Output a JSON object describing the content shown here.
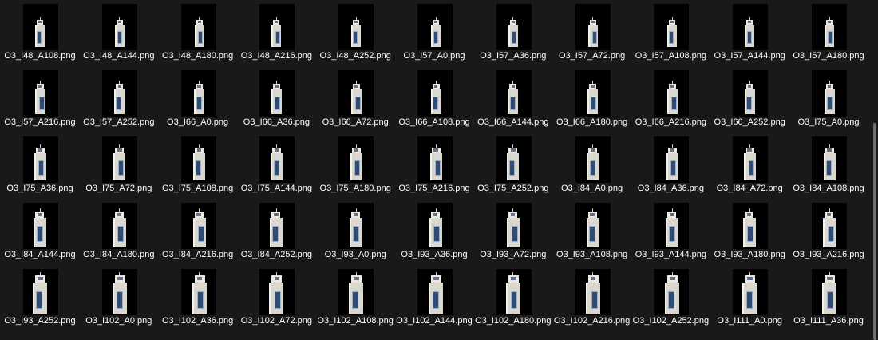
{
  "files": [
    {
      "name": "O3_I48_A108.png"
    },
    {
      "name": "O3_I48_A144.png"
    },
    {
      "name": "O3_I48_A180.png"
    },
    {
      "name": "O3_I48_A216.png"
    },
    {
      "name": "O3_I48_A252.png"
    },
    {
      "name": "O3_I57_A0.png"
    },
    {
      "name": "O3_I57_A36.png"
    },
    {
      "name": "O3_I57_A72.png"
    },
    {
      "name": "O3_I57_A108.png"
    },
    {
      "name": "O3_I57_A144.png"
    },
    {
      "name": "O3_I57_A180.png"
    },
    {
      "name": "O3_I57_A216.png"
    },
    {
      "name": "O3_I57_A252.png"
    },
    {
      "name": "O3_I66_A0.png"
    },
    {
      "name": "O3_I66_A36.png"
    },
    {
      "name": "O3_I66_A72.png"
    },
    {
      "name": "O3_I66_A108.png"
    },
    {
      "name": "O3_I66_A144.png"
    },
    {
      "name": "O3_I66_A180.png"
    },
    {
      "name": "O3_I66_A216.png"
    },
    {
      "name": "O3_I66_A252.png"
    },
    {
      "name": "O3_I75_A0.png"
    },
    {
      "name": "O3_I75_A36.png"
    },
    {
      "name": "O3_I75_A72.png"
    },
    {
      "name": "O3_I75_A108.png"
    },
    {
      "name": "O3_I75_A144.png"
    },
    {
      "name": "O3_I75_A180.png"
    },
    {
      "name": "O3_I75_A216.png"
    },
    {
      "name": "O3_I75_A252.png"
    },
    {
      "name": "O3_I84_A0.png"
    },
    {
      "name": "O3_I84_A36.png"
    },
    {
      "name": "O3_I84_A72.png"
    },
    {
      "name": "O3_I84_A108.png"
    },
    {
      "name": "O3_I84_A144.png"
    },
    {
      "name": "O3_I84_A180.png"
    },
    {
      "name": "O3_I84_A216.png"
    },
    {
      "name": "O3_I84_A252.png"
    },
    {
      "name": "O3_I93_A0.png"
    },
    {
      "name": "O3_I93_A36.png"
    },
    {
      "name": "O3_I93_A72.png"
    },
    {
      "name": "O3_I93_A108.png"
    },
    {
      "name": "O3_I93_A144.png"
    },
    {
      "name": "O3_I93_A180.png"
    },
    {
      "name": "O3_I93_A216.png"
    },
    {
      "name": "O3_I93_A252.png"
    },
    {
      "name": "O3_I102_A0.png"
    },
    {
      "name": "O3_I102_A36.png"
    },
    {
      "name": "O3_I102_A72.png"
    },
    {
      "name": "O3_I102_A108.png"
    },
    {
      "name": "O3_I102_A144.png"
    },
    {
      "name": "O3_I102_A180.png"
    },
    {
      "name": "O3_I102_A216.png"
    },
    {
      "name": "O3_I102_A252.png"
    },
    {
      "name": "O3_I111_A0.png"
    },
    {
      "name": "O3_I111_A36.png"
    }
  ],
  "thumbnail_subject": "lighthouse-render",
  "colors": {
    "background": "#191919",
    "text": "#ffffff",
    "thumbnail_bg": "#000000",
    "tower": "#d9d7cf",
    "window": "#2f4d74",
    "scrollbar_thumb": "#6f6f6f"
  }
}
